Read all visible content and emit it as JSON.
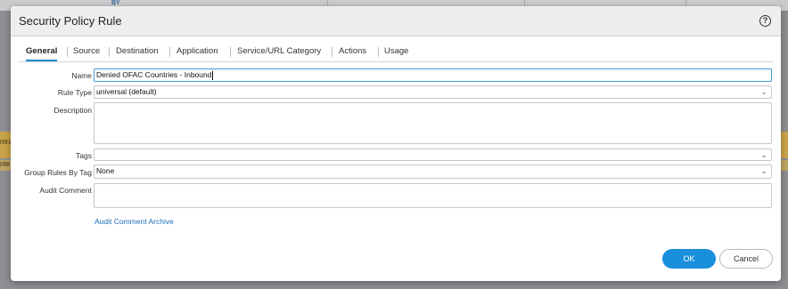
{
  "background": {
    "by_label": "BY",
    "band_text_1": "ntra",
    "band_text_2": "nte"
  },
  "dialog": {
    "title": "Security Policy Rule",
    "help_icon": "?"
  },
  "tabs": [
    {
      "label": "General",
      "active": true
    },
    {
      "label": "Source",
      "active": false
    },
    {
      "label": "Destination",
      "active": false
    },
    {
      "label": "Application",
      "active": false
    },
    {
      "label": "Service/URL Category",
      "active": false
    },
    {
      "label": "Actions",
      "active": false
    },
    {
      "label": "Usage",
      "active": false
    }
  ],
  "form": {
    "name": {
      "label": "Name",
      "value": "Denied OFAC Countries - Inbound"
    },
    "rule_type": {
      "label": "Rule Type",
      "value": "universal (default)"
    },
    "description": {
      "label": "Description",
      "value": ""
    },
    "tags": {
      "label": "Tags",
      "value": ""
    },
    "group_rules_by_tag": {
      "label": "Group Rules By Tag",
      "value": "None"
    },
    "audit_comment": {
      "label": "Audit Comment",
      "value": ""
    },
    "audit_comment_archive_link": "Audit Comment Archive"
  },
  "buttons": {
    "ok": "OK",
    "cancel": "Cancel"
  },
  "colors": {
    "accent": "#1a8fdc",
    "link": "#1f6fb8"
  }
}
